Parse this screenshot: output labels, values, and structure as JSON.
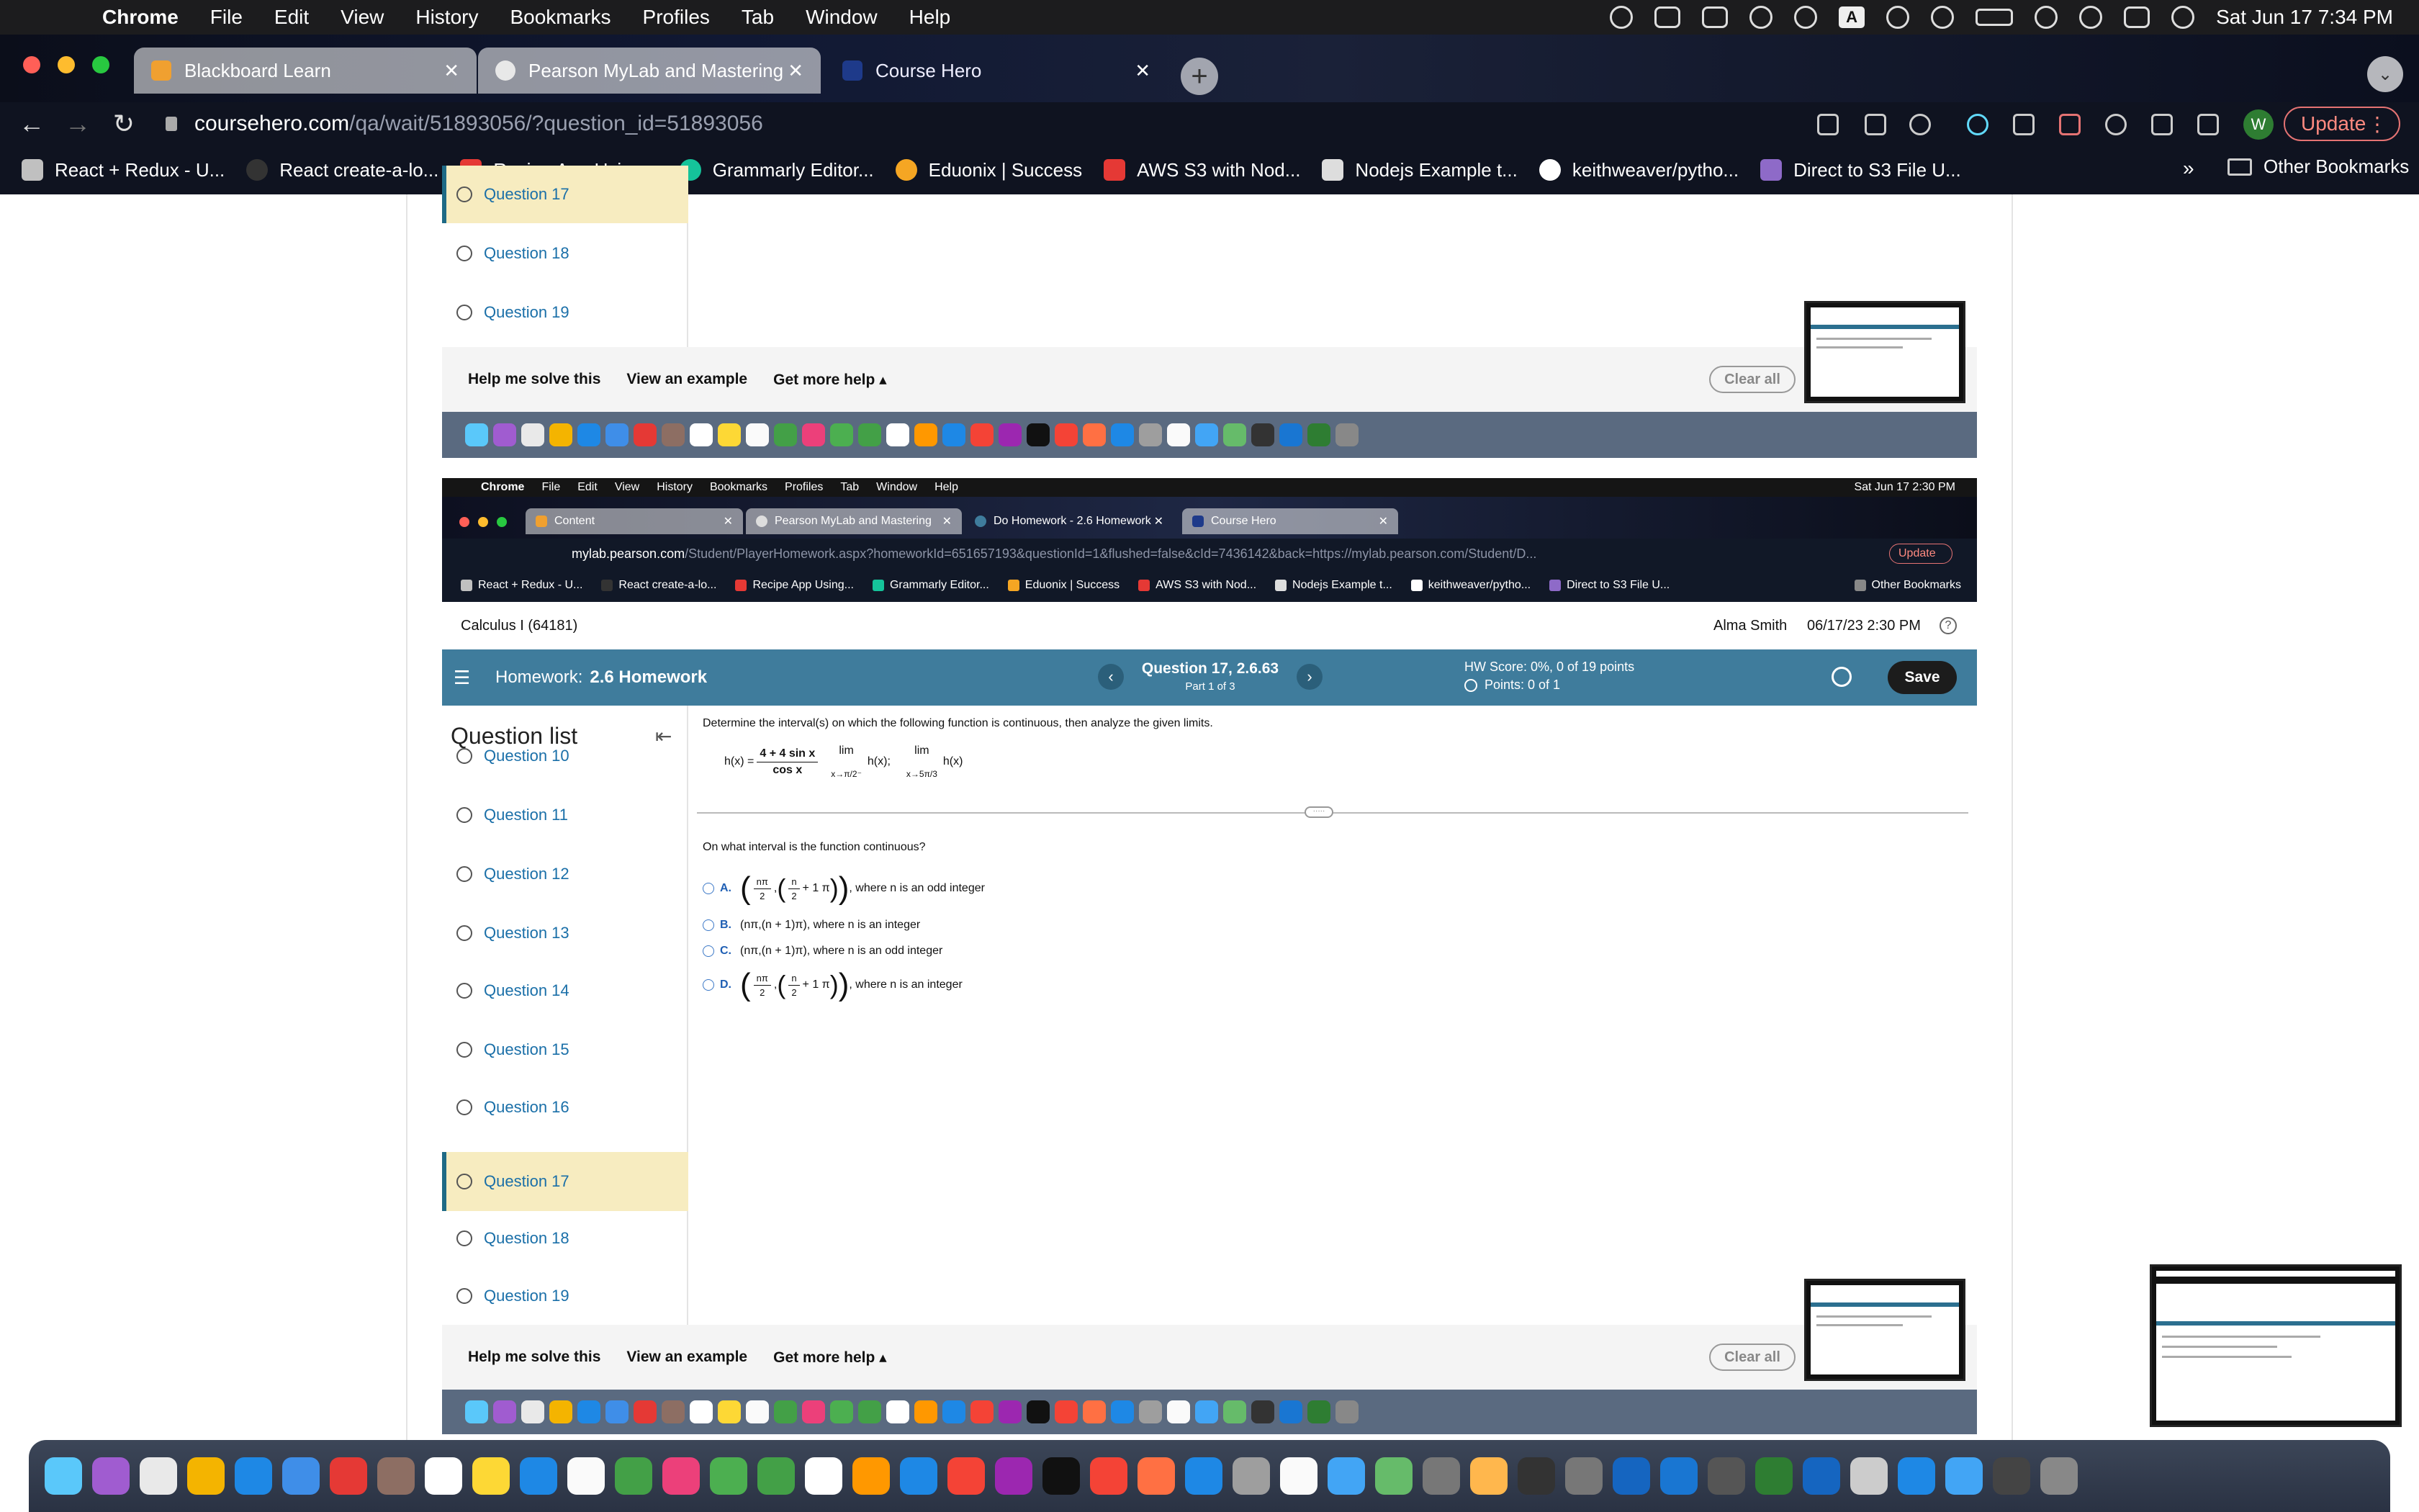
{
  "menubar": {
    "app": "Chrome",
    "items": [
      "File",
      "Edit",
      "View",
      "History",
      "Bookmarks",
      "Profiles",
      "Tab",
      "Window",
      "Help"
    ],
    "clock": "Sat Jun 17  7:34 PM",
    "input_indicator": "A"
  },
  "browser": {
    "tabs": [
      {
        "label": "Blackboard Learn",
        "color": "#f0a030"
      },
      {
        "label": "Pearson MyLab and Mastering",
        "color": "#e8e8e8"
      },
      {
        "label": "Course Hero",
        "color": "#1e3a8a"
      }
    ],
    "url_host": "coursehero.com",
    "url_path": "/qa/wait/51893056/?question_id=51893056",
    "avatar": "W",
    "update_label": "Update"
  },
  "bookmarks": [
    {
      "label": "React + Redux - U...",
      "color": "#c0c0c0"
    },
    {
      "label": "React create-a-lo...",
      "color": "#333333"
    },
    {
      "label": "Recipe App Using...",
      "color": "#e53935"
    },
    {
      "label": "Grammarly Editor...",
      "color": "#15c39a"
    },
    {
      "label": "Eduonix | Success",
      "color": "#f5a623"
    },
    {
      "label": "AWS S3 with Nod...",
      "color": "#e53935"
    },
    {
      "label": "Nodejs Example t...",
      "color": "#dddddd"
    },
    {
      "label": "keithweaver/pytho...",
      "color": "#ffffff"
    },
    {
      "label": "Direct to S3 File U...",
      "color": "#8e6ac8"
    }
  ],
  "bookmarks_more": "»",
  "other_bookmarks": "Other Bookmarks",
  "top_piece": {
    "questions": [
      "Question 17",
      "Question 18",
      "Question 19"
    ],
    "selected": "Question 17"
  },
  "help_bar": {
    "help_me": "Help me solve this",
    "example": "View an example",
    "more": "Get more help ▴",
    "clear": "Clear all"
  },
  "inner": {
    "menubar": {
      "app": "Chrome",
      "items": [
        "File",
        "Edit",
        "View",
        "History",
        "Bookmarks",
        "Profiles",
        "Tab",
        "Window",
        "Help"
      ],
      "clock": "Sat Jun 17  2:30 PM"
    },
    "tabs": [
      "Content",
      "Pearson MyLab and Mastering",
      "Do Homework - 2.6 Homework",
      "Course Hero"
    ],
    "url_host": "mylab.pearson.com",
    "url_path": "/Student/PlayerHomework.aspx?homeworkId=651657193&questionId=1&flushed=false&cId=7436142&back=https://mylab.pearson.com/Student/D...",
    "update_label": "Update",
    "bookmarks": [
      "React + Redux - U...",
      "React create-a-lo...",
      "Recipe App Using...",
      "Grammarly Editor...",
      "Eduonix | Success",
      "AWS S3 with Nod...",
      "Nodejs Example t...",
      "keithweaver/pytho...",
      "Direct to S3 File U..."
    ],
    "other_bookmarks": "Other Bookmarks"
  },
  "course": {
    "name": "Calculus I (64181)",
    "user": "Alma Smith",
    "datetime": "06/17/23 2:30 PM",
    "help": "?"
  },
  "homework": {
    "label": "Homework:",
    "name": "2.6 Homework",
    "question": "Question 17, 2.6.63",
    "part": "Part 1 of 3",
    "score": "HW Score: 0%, 0 of 19 points",
    "points": "Points: 0 of 1",
    "save": "Save",
    "prev": "‹",
    "next": "›"
  },
  "question_list": {
    "title": "Question list",
    "items": [
      "Question 10",
      "Question 11",
      "Question 12",
      "Question 13",
      "Question 14",
      "Question 15",
      "Question 16",
      "Question 17",
      "Question 18",
      "Question 19"
    ],
    "selected": "Question 17"
  },
  "problem": {
    "prompt": "Determine the interval(s) on which the following function is continuous, then analyze the given limits.",
    "fx_left": "h(x) =",
    "fx_num": "4 + 4 sin x",
    "fx_den": "cos x",
    "lim1_word": "lim",
    "lim1_expr": "h(x);",
    "lim1_sub": "x→π/2⁻",
    "lim2_word": "lim",
    "lim2_expr": "h(x)",
    "lim2_sub": "x→5π/3",
    "handle": "·····",
    "subq": "On what interval is the function continuous?",
    "options": [
      {
        "letter": "A.",
        "text": ", where n is an odd integer",
        "f1n": "nπ",
        "f1d": "2",
        "f2n": "n",
        "f2d": "2",
        "tail": "+ 1 π"
      },
      {
        "letter": "B.",
        "text": "(nπ,(n + 1)π), where n is an integer"
      },
      {
        "letter": "C.",
        "text": "(nπ,(n + 1)π), where n is an odd integer"
      },
      {
        "letter": "D.",
        "text": ", where n is an integer",
        "f1n": "nπ",
        "f1d": "2",
        "f2n": "n",
        "f2d": "2",
        "tail": "+ 1 π"
      }
    ]
  },
  "colors": {
    "header": "#3f7c9c",
    "selected_row": "#f7ecc0",
    "link": "#1a6fa8"
  }
}
